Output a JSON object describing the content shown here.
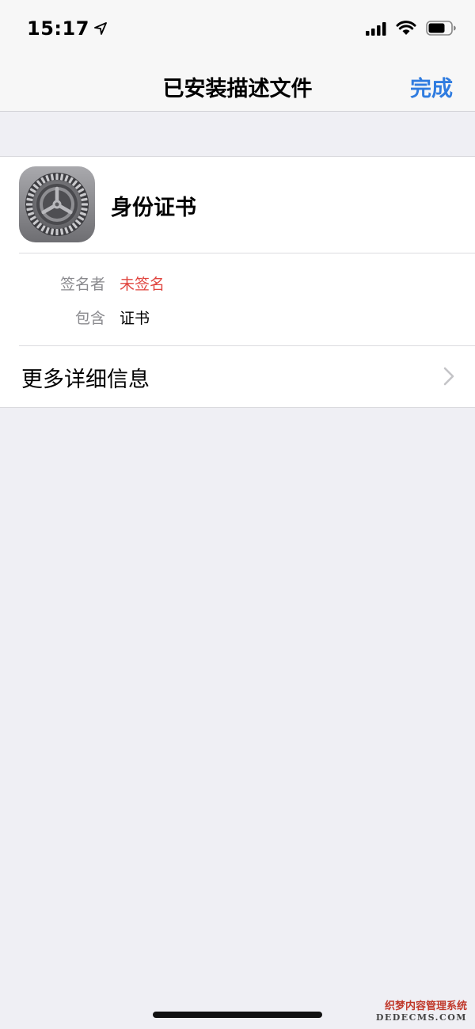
{
  "status_bar": {
    "time": "15:17",
    "icons": [
      "location-arrow-icon",
      "signal-icon",
      "wifi-icon",
      "battery-icon"
    ]
  },
  "nav": {
    "title": "已安装描述文件",
    "done_label": "完成"
  },
  "profile": {
    "icon": "settings-gear-icon",
    "name": "身份证书",
    "details": [
      {
        "label": "签名者",
        "value": "未签名",
        "value_color": "#e0443e"
      },
      {
        "label": "包含",
        "value": "证书",
        "value_color": "#000000"
      }
    ],
    "more_label": "更多详细信息"
  },
  "watermark": {
    "cn": "织梦内容管理系统",
    "en": "DEDECMS.COM"
  },
  "colors": {
    "accent": "#2f7ce0",
    "unsigned": "#e0443e",
    "background": "#efeff4"
  }
}
